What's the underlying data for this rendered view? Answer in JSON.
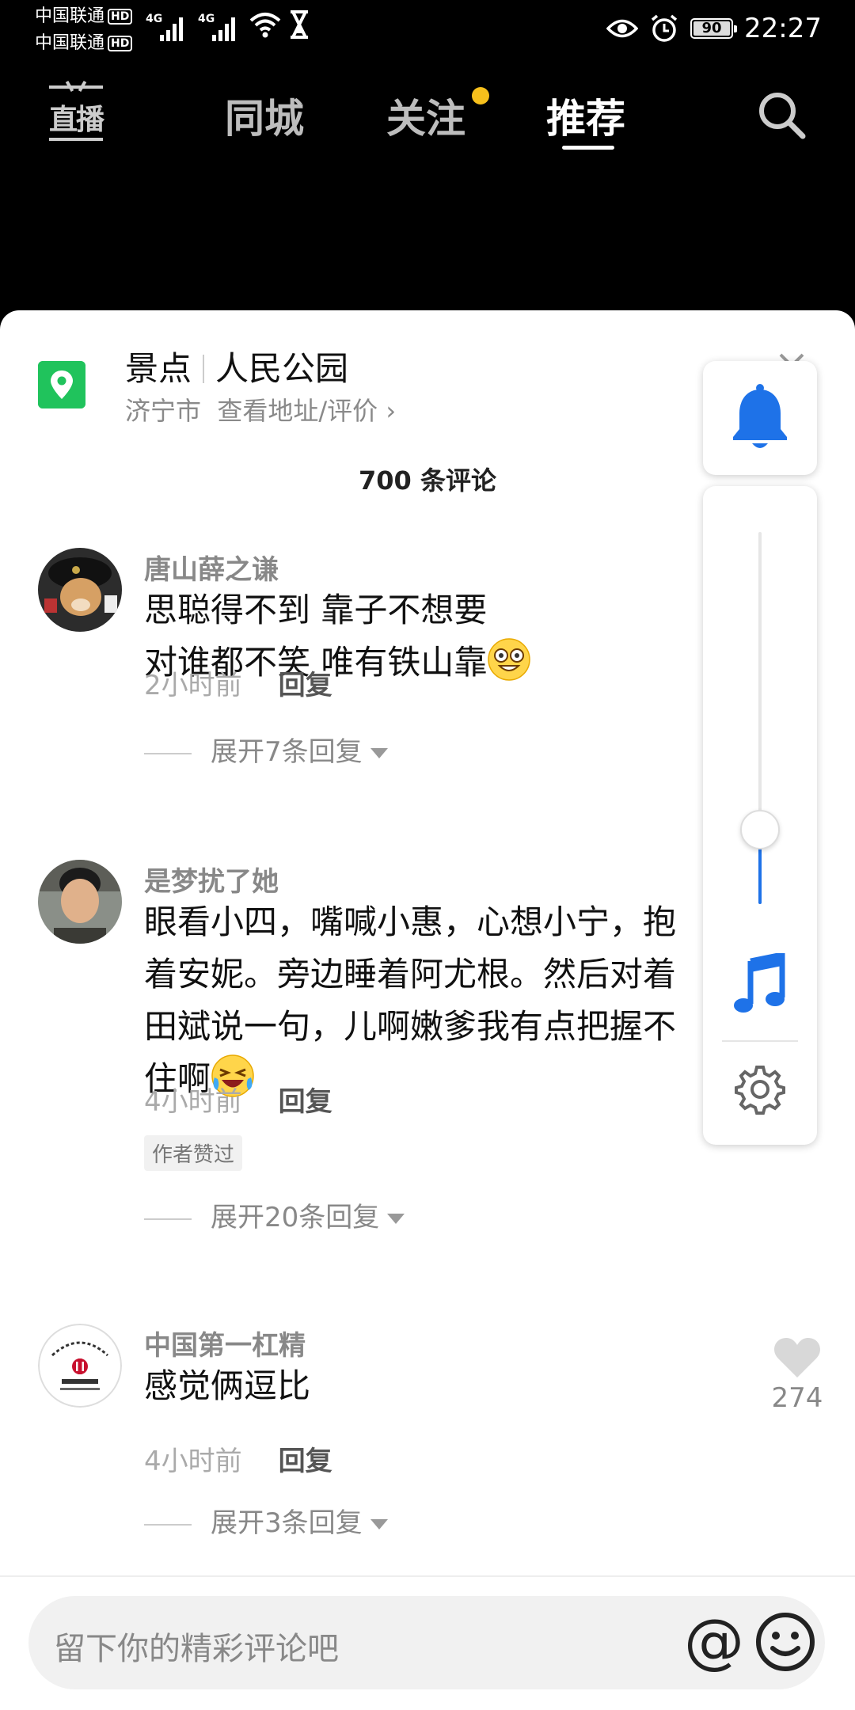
{
  "status_bar": {
    "carrier1": "中国联通",
    "carrier2": "中国联通",
    "hd": "HD",
    "net1": "4G",
    "net2": "4G",
    "battery": "90",
    "time": "22:27"
  },
  "top_nav": {
    "live_label": "直播",
    "tabs": [
      "同城",
      "关注",
      "推荐"
    ],
    "active_tab": "推荐",
    "badge_color": "#F7C01C"
  },
  "location": {
    "category": "景点",
    "name": "人民公园",
    "city": "济宁市",
    "link": "查看地址/评价 ›"
  },
  "comments_count": "700 条评论",
  "comments": [
    {
      "user": "唐山薛之谦",
      "text": "思聪得不到 靠子不想要\n对谁都不笑 唯有铁山靠",
      "time": "2小时前",
      "reply_label": "回复",
      "expand": "展开7条回复"
    },
    {
      "user": "是梦扰了她",
      "text": "眼看小四，嘴喊小惠，心想小宁，抱\n着安妮。旁边睡着阿尤根。然后对着\n田斌说一句，儿啊嫩爹我有点把握不\n住啊",
      "time": "4小时前",
      "reply_label": "回复",
      "badge": "作者赞过",
      "expand": "展开20条回复"
    },
    {
      "user": "中国第一杠精",
      "text": "感觉俩逗比",
      "time": "4小时前",
      "reply_label": "回复",
      "expand": "展开3条回复",
      "likes": "274"
    }
  ],
  "volume_panel": {
    "level": 0.2,
    "accent": "#1E72E8"
  },
  "input": {
    "placeholder": "留下你的精彩评论吧",
    "at_symbol": "@"
  }
}
